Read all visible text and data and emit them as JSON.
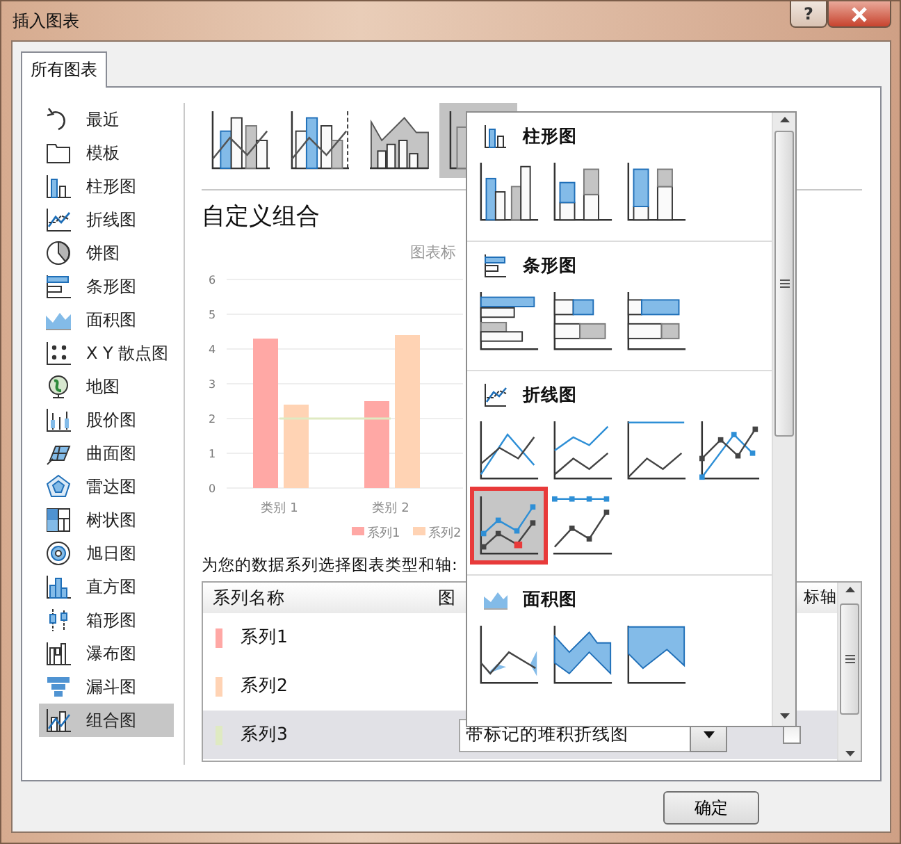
{
  "window": {
    "title": "插入图表",
    "help_button": "?"
  },
  "tabs": [
    {
      "label": "所有图表",
      "selected": true
    }
  ],
  "sidebar": {
    "items": [
      {
        "label": "最近",
        "selected": false
      },
      {
        "label": "模板",
        "selected": false
      },
      {
        "label": "柱形图",
        "selected": false
      },
      {
        "label": "折线图",
        "selected": false
      },
      {
        "label": "饼图",
        "selected": false
      },
      {
        "label": "条形图",
        "selected": false
      },
      {
        "label": "面积图",
        "selected": false
      },
      {
        "label": "X Y 散点图",
        "selected": false
      },
      {
        "label": "地图",
        "selected": false
      },
      {
        "label": "股价图",
        "selected": false
      },
      {
        "label": "曲面图",
        "selected": false
      },
      {
        "label": "雷达图",
        "selected": false
      },
      {
        "label": "树状图",
        "selected": false
      },
      {
        "label": "旭日图",
        "selected": false
      },
      {
        "label": "直方图",
        "selected": false
      },
      {
        "label": "箱形图",
        "selected": false
      },
      {
        "label": "瀑布图",
        "selected": false
      },
      {
        "label": "漏斗图",
        "selected": false
      },
      {
        "label": "组合图",
        "selected": true
      }
    ]
  },
  "subtypes": [
    {
      "selected": false
    },
    {
      "selected": false
    },
    {
      "selected": false
    },
    {
      "selected": true
    }
  ],
  "heading": "自定义组合",
  "chart_data": {
    "type": "bar",
    "title": "图表标",
    "categories": [
      "类别 1",
      "类别 2"
    ],
    "ylim": [
      0,
      6
    ],
    "yticks": [
      0,
      1,
      2,
      3,
      4,
      5,
      6
    ],
    "grid": true,
    "series": [
      {
        "name": "系列1",
        "color": "#ffa8a5",
        "values": [
          4.3,
          2.5
        ]
      },
      {
        "name": "系列2",
        "color": "#ffd3b4",
        "values": [
          2.4,
          4.4
        ]
      },
      {
        "color": "#dfeac2",
        "values": [
          2,
          2
        ],
        "type": "line"
      }
    ],
    "legend": true
  },
  "series_label": "为您的数据系列选择图表类型和轴:",
  "series_table": {
    "columns": [
      "系列名称",
      "图",
      "标轴"
    ],
    "rows": [
      {
        "name": "系列1",
        "color": "#ffa8a5",
        "selected": false
      },
      {
        "name": "系列2",
        "color": "#ffd3b4",
        "selected": false
      },
      {
        "name": "系列3",
        "color": "#dfeac2",
        "selected": true,
        "chart_type": "带标记的堆积折线图",
        "secondary_axis": false
      }
    ]
  },
  "dropdown": {
    "groups": [
      {
        "label": "柱形图",
        "options": [
          {
            "selected": false
          },
          {
            "selected": false
          },
          {
            "selected": false
          }
        ]
      },
      {
        "label": "条形图",
        "options": [
          {
            "selected": false
          },
          {
            "selected": false
          },
          {
            "selected": false
          }
        ]
      },
      {
        "label": "折线图",
        "options": [
          {
            "selected": false
          },
          {
            "selected": false
          },
          {
            "selected": false
          },
          {
            "selected": false
          },
          {
            "selected": true
          },
          {
            "selected": false
          }
        ]
      },
      {
        "label": "面积图",
        "options": [
          {
            "selected": false
          },
          {
            "selected": false
          },
          {
            "selected": false
          }
        ]
      }
    ]
  },
  "buttons": [
    "确定"
  ]
}
